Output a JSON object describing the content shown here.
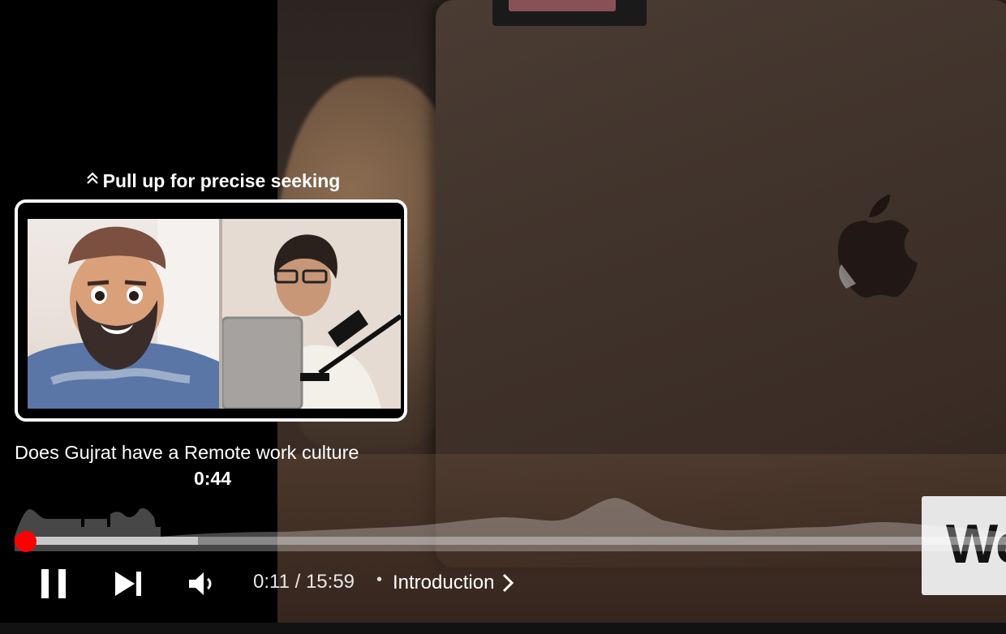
{
  "player": {
    "seek_hint": "Pull up for precise seeking",
    "preview_title": "Does Gujrat have a Remote work culture",
    "preview_time": "0:44",
    "current_time": "0:11",
    "duration": "15:59",
    "time_separator": "/",
    "chapter_label": "Introduction",
    "played_fraction": 0.0115,
    "loaded_fraction": 0.185,
    "overlay_card_text": "We",
    "accent_color": "#ff0000"
  },
  "icons": {
    "seek_hint": "chevron-double-up-icon",
    "pause": "pause-icon",
    "next": "skip-next-icon",
    "volume": "volume-icon",
    "chapter": "chevron-right-icon"
  }
}
